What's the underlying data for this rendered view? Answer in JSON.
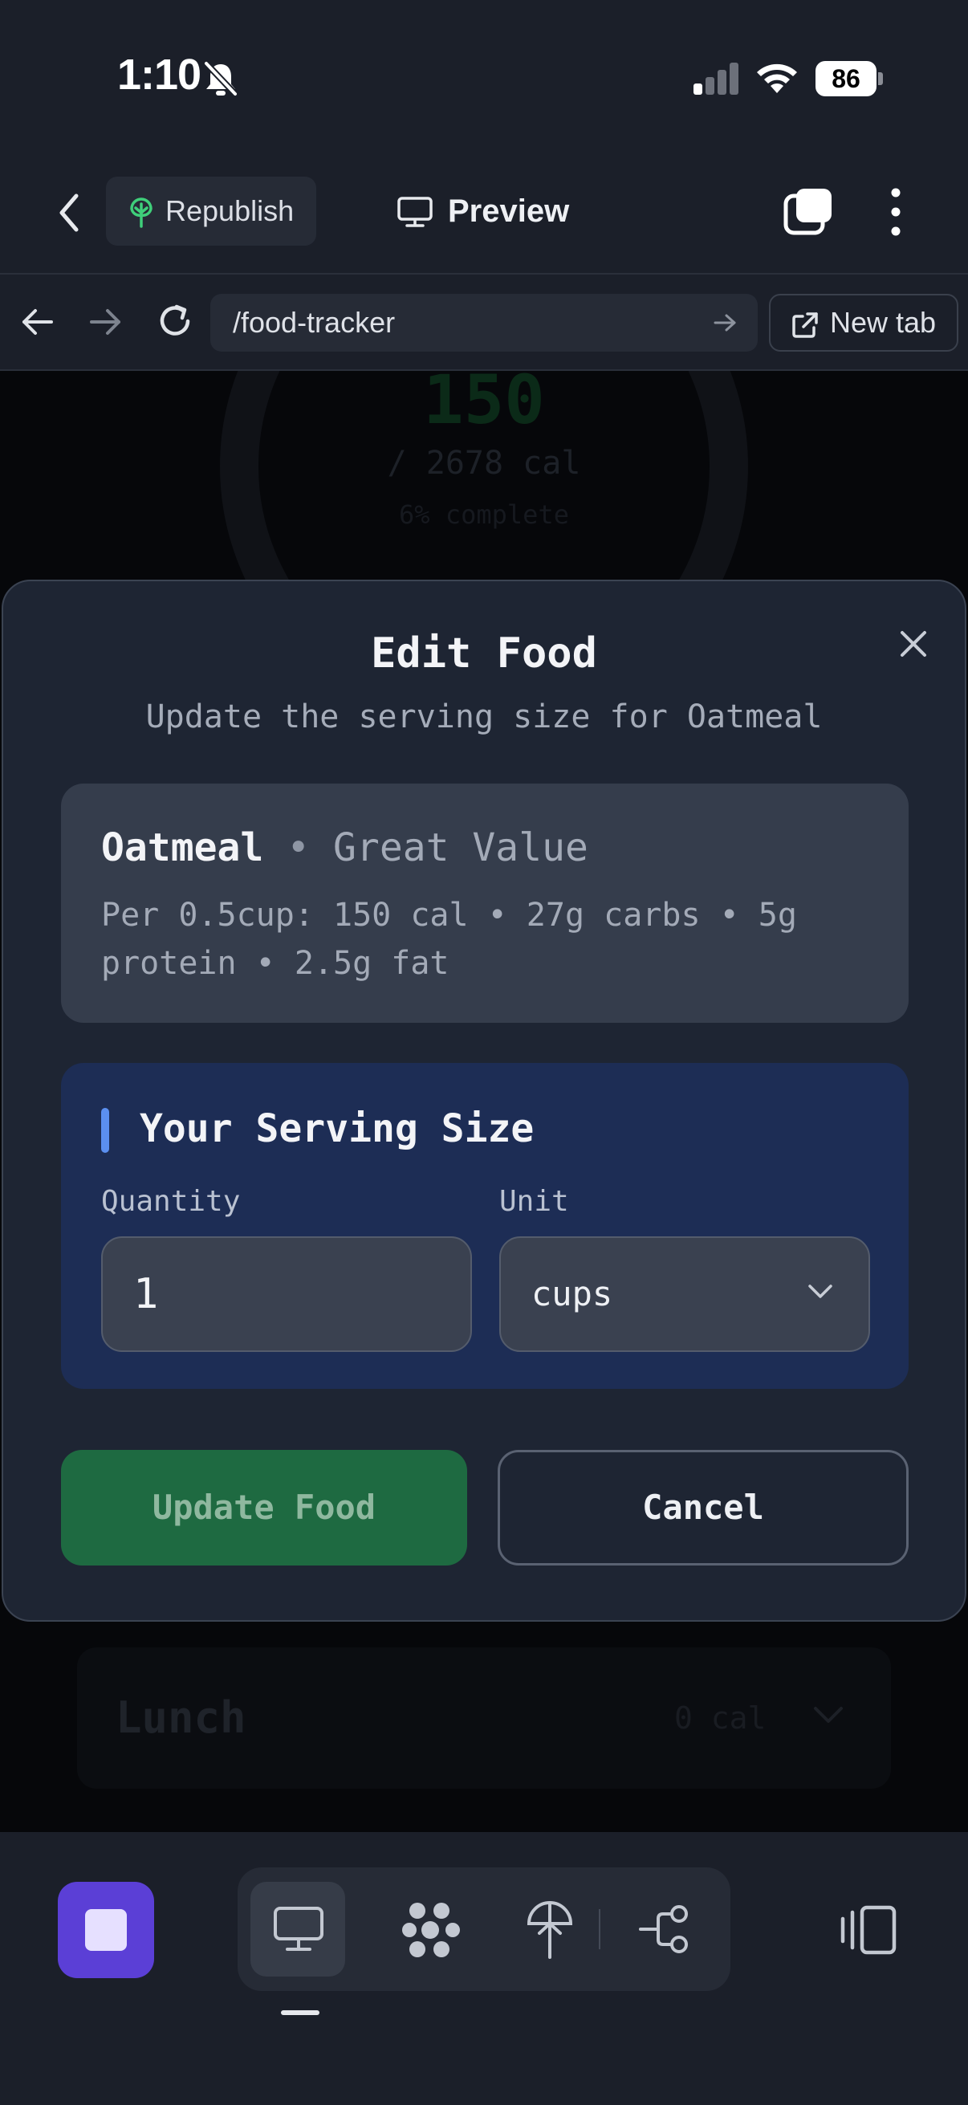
{
  "status_bar": {
    "time": "1:10",
    "battery": "86",
    "icons": [
      "bell-slash-icon",
      "signal-icon",
      "wifi-icon",
      "battery-icon"
    ]
  },
  "header": {
    "republish_label": "Republish",
    "preview_label": "Preview"
  },
  "browser": {
    "url": "/food-tracker",
    "new_tab_label": "New tab"
  },
  "background_page": {
    "calories_consumed": "150",
    "calories_goal": "/ 2678 cal",
    "percent_complete": "6% complete",
    "meal_name": "Lunch",
    "meal_calories": "0 cal"
  },
  "modal": {
    "title": "Edit Food",
    "subtitle": "Update the serving size for Oatmeal",
    "food": {
      "name": "Oatmeal",
      "separator": "•",
      "brand": "Great Value",
      "nutrition": "Per 0.5cup: 150 cal • 27g carbs • 5g protein • 2.5g fat"
    },
    "serving": {
      "title": "Your Serving Size",
      "quantity_label": "Quantity",
      "quantity_value": "1",
      "unit_label": "Unit",
      "unit_value": "cups"
    },
    "update_label": "Update Food",
    "cancel_label": "Cancel"
  },
  "colors": {
    "background": "#1b1f29",
    "modal": "#1e2533",
    "food_card": "#353d4c",
    "serving_card": "#1d2d55",
    "accent_bar": "#5b8ff0",
    "update_button": "#1e6a41",
    "stop_button": "#5b3fd6"
  }
}
